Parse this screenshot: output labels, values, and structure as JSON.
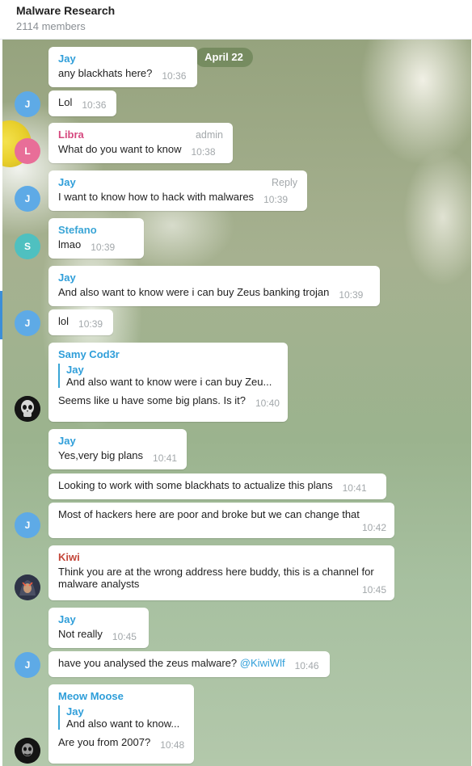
{
  "chat": {
    "title": "Malware Research",
    "members": "2114 members"
  },
  "date_separator": "April 22",
  "messages": [
    {
      "sender": "Jay",
      "text": "any blackhats here?",
      "time": "10:36"
    },
    {
      "text": "Lol",
      "time": "10:36",
      "avatar_letter": "J"
    },
    {
      "sender": "Libra",
      "text": "What do you want to know",
      "time": "10:38",
      "role": "admin",
      "avatar_letter": "L"
    },
    {
      "sender": "Jay",
      "text": "I want to know how to hack with malwares",
      "time": "10:39",
      "action": "Reply",
      "avatar_letter": "J"
    },
    {
      "sender": "Stefano",
      "text": "lmao",
      "time": "10:39",
      "avatar_letter": "S"
    },
    {
      "sender": "Jay",
      "text": "And also want to know were i can buy Zeus banking trojan",
      "time": "10:39"
    },
    {
      "text": "lol",
      "time": "10:39",
      "avatar_letter": "J"
    },
    {
      "sender": "Samy Cod3r",
      "reply_to": {
        "name": "Jay",
        "text": "And also want to know were i can buy Zeu..."
      },
      "text": "Seems like u have some big plans. Is it?",
      "time": "10:40"
    },
    {
      "sender": "Jay",
      "text": "Yes,very big plans",
      "time": "10:41"
    },
    {
      "text": "Looking to work with some blackhats to actualize this plans",
      "time": "10:41"
    },
    {
      "text": "Most of hackers here are poor and broke but we can change that",
      "time": "10:42",
      "avatar_letter": "J"
    },
    {
      "sender": "Kiwi",
      "text_line1": "Think you are at the wrong address here buddy, this is a channel for",
      "text_line2": "malware analysts",
      "time": "10:45"
    },
    {
      "sender": "Jay",
      "text": "Not really",
      "time": "10:45"
    },
    {
      "text": "have you analysed the zeus malware?",
      "mention": "@KiwiWlf",
      "time": "10:46",
      "avatar_letter": "J"
    },
    {
      "sender": "Meow Moose",
      "reply_to": {
        "name": "Jay",
        "text": "And also want to know..."
      },
      "text": "Are you from 2007?",
      "time": "10:48"
    }
  ],
  "colors": {
    "link_blue": "#2f9ed9",
    "libra_pink": "#d6497f",
    "kiwi_red": "#c4473a",
    "avatar_blue": "#5eaae6",
    "avatar_pink": "#e86e98",
    "avatar_teal": "#4fc0c0",
    "date_pill": "#70875a"
  },
  "icons": [
    "skull-avatar-icon",
    "hooded-figure-avatar-icon",
    "dark-mask-avatar-icon"
  ]
}
